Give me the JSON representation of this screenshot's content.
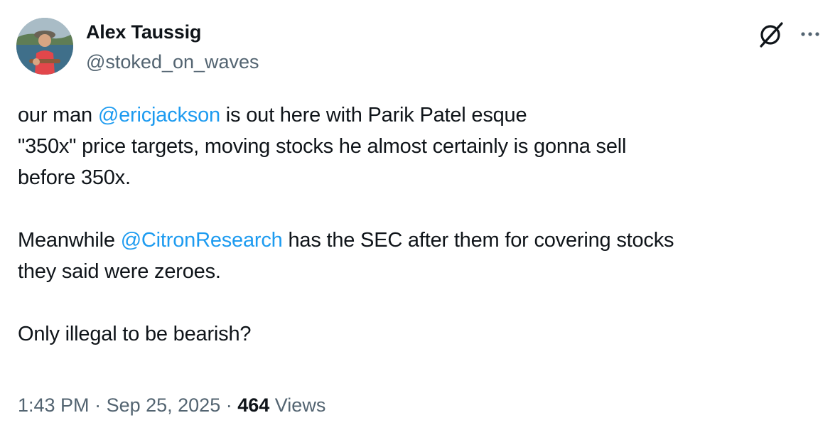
{
  "author": {
    "display_name": "Alex Taussig",
    "handle": "@stoked_on_waves",
    "avatar_icon": "profile-photo"
  },
  "header_icons": {
    "grok": "grok-icon",
    "more": "more-options-icon"
  },
  "tweet": {
    "p1": {
      "l1_a": "our man ",
      "l1_mention": "@ericjackson",
      "l1_b": " is out here with Parik Patel esque",
      "l2": "\"350x\" price targets, moving stocks he almost certainly is gonna sell",
      "l3": "before 350x."
    },
    "p2": {
      "l1_a": "Meanwhile ",
      "l1_mention": "@CitronResearch",
      "l1_b": " has the SEC after them for covering stocks",
      "l2": "they said were zeroes."
    },
    "p3": {
      "l1": "Only illegal to be bearish?"
    }
  },
  "meta": {
    "time": "1:43 PM",
    "separator": " · ",
    "date": "Sep 25, 2025",
    "views_count": "464",
    "views_label": " Views"
  },
  "colors": {
    "link": "#1d9bf0",
    "secondary_text": "#536471",
    "primary_text": "#0f1419"
  }
}
